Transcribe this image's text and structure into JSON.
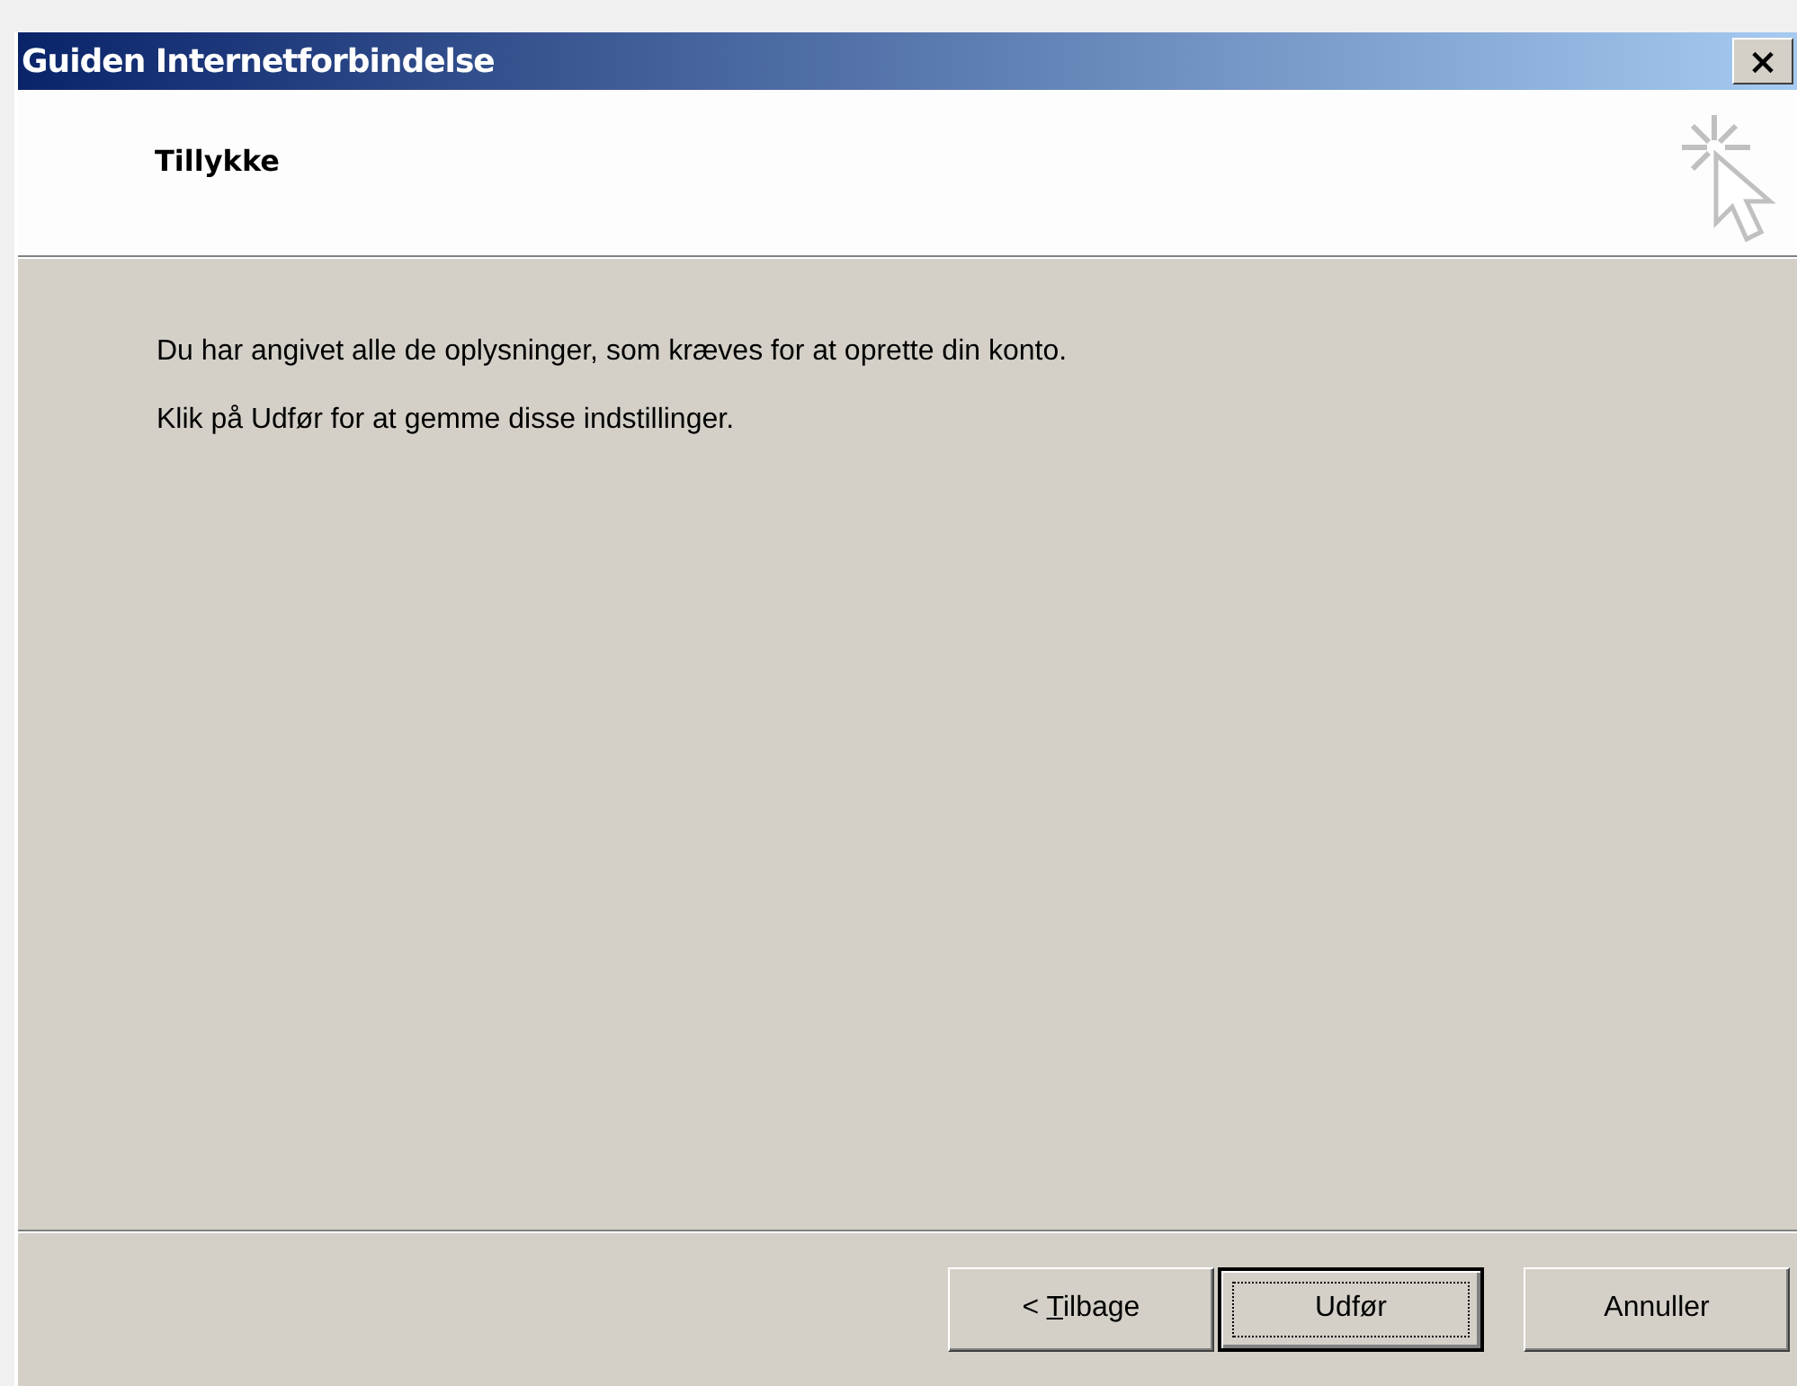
{
  "window": {
    "title": "Guiden Internetforbindelse",
    "close": "×"
  },
  "header": {
    "title": "Tillykke"
  },
  "body": {
    "paragraphs": [
      "Du har angivet alle de oplysninger, som kræves for at oprette din konto.",
      "Klik på Udfør for at gemme disse indstillinger."
    ]
  },
  "buttons": [
    {
      "label": "< Tilbage",
      "access_key_underlined": true,
      "default": false
    },
    {
      "label": "Udfør",
      "default": true
    },
    {
      "label": "Annuller",
      "default": false
    }
  ]
}
